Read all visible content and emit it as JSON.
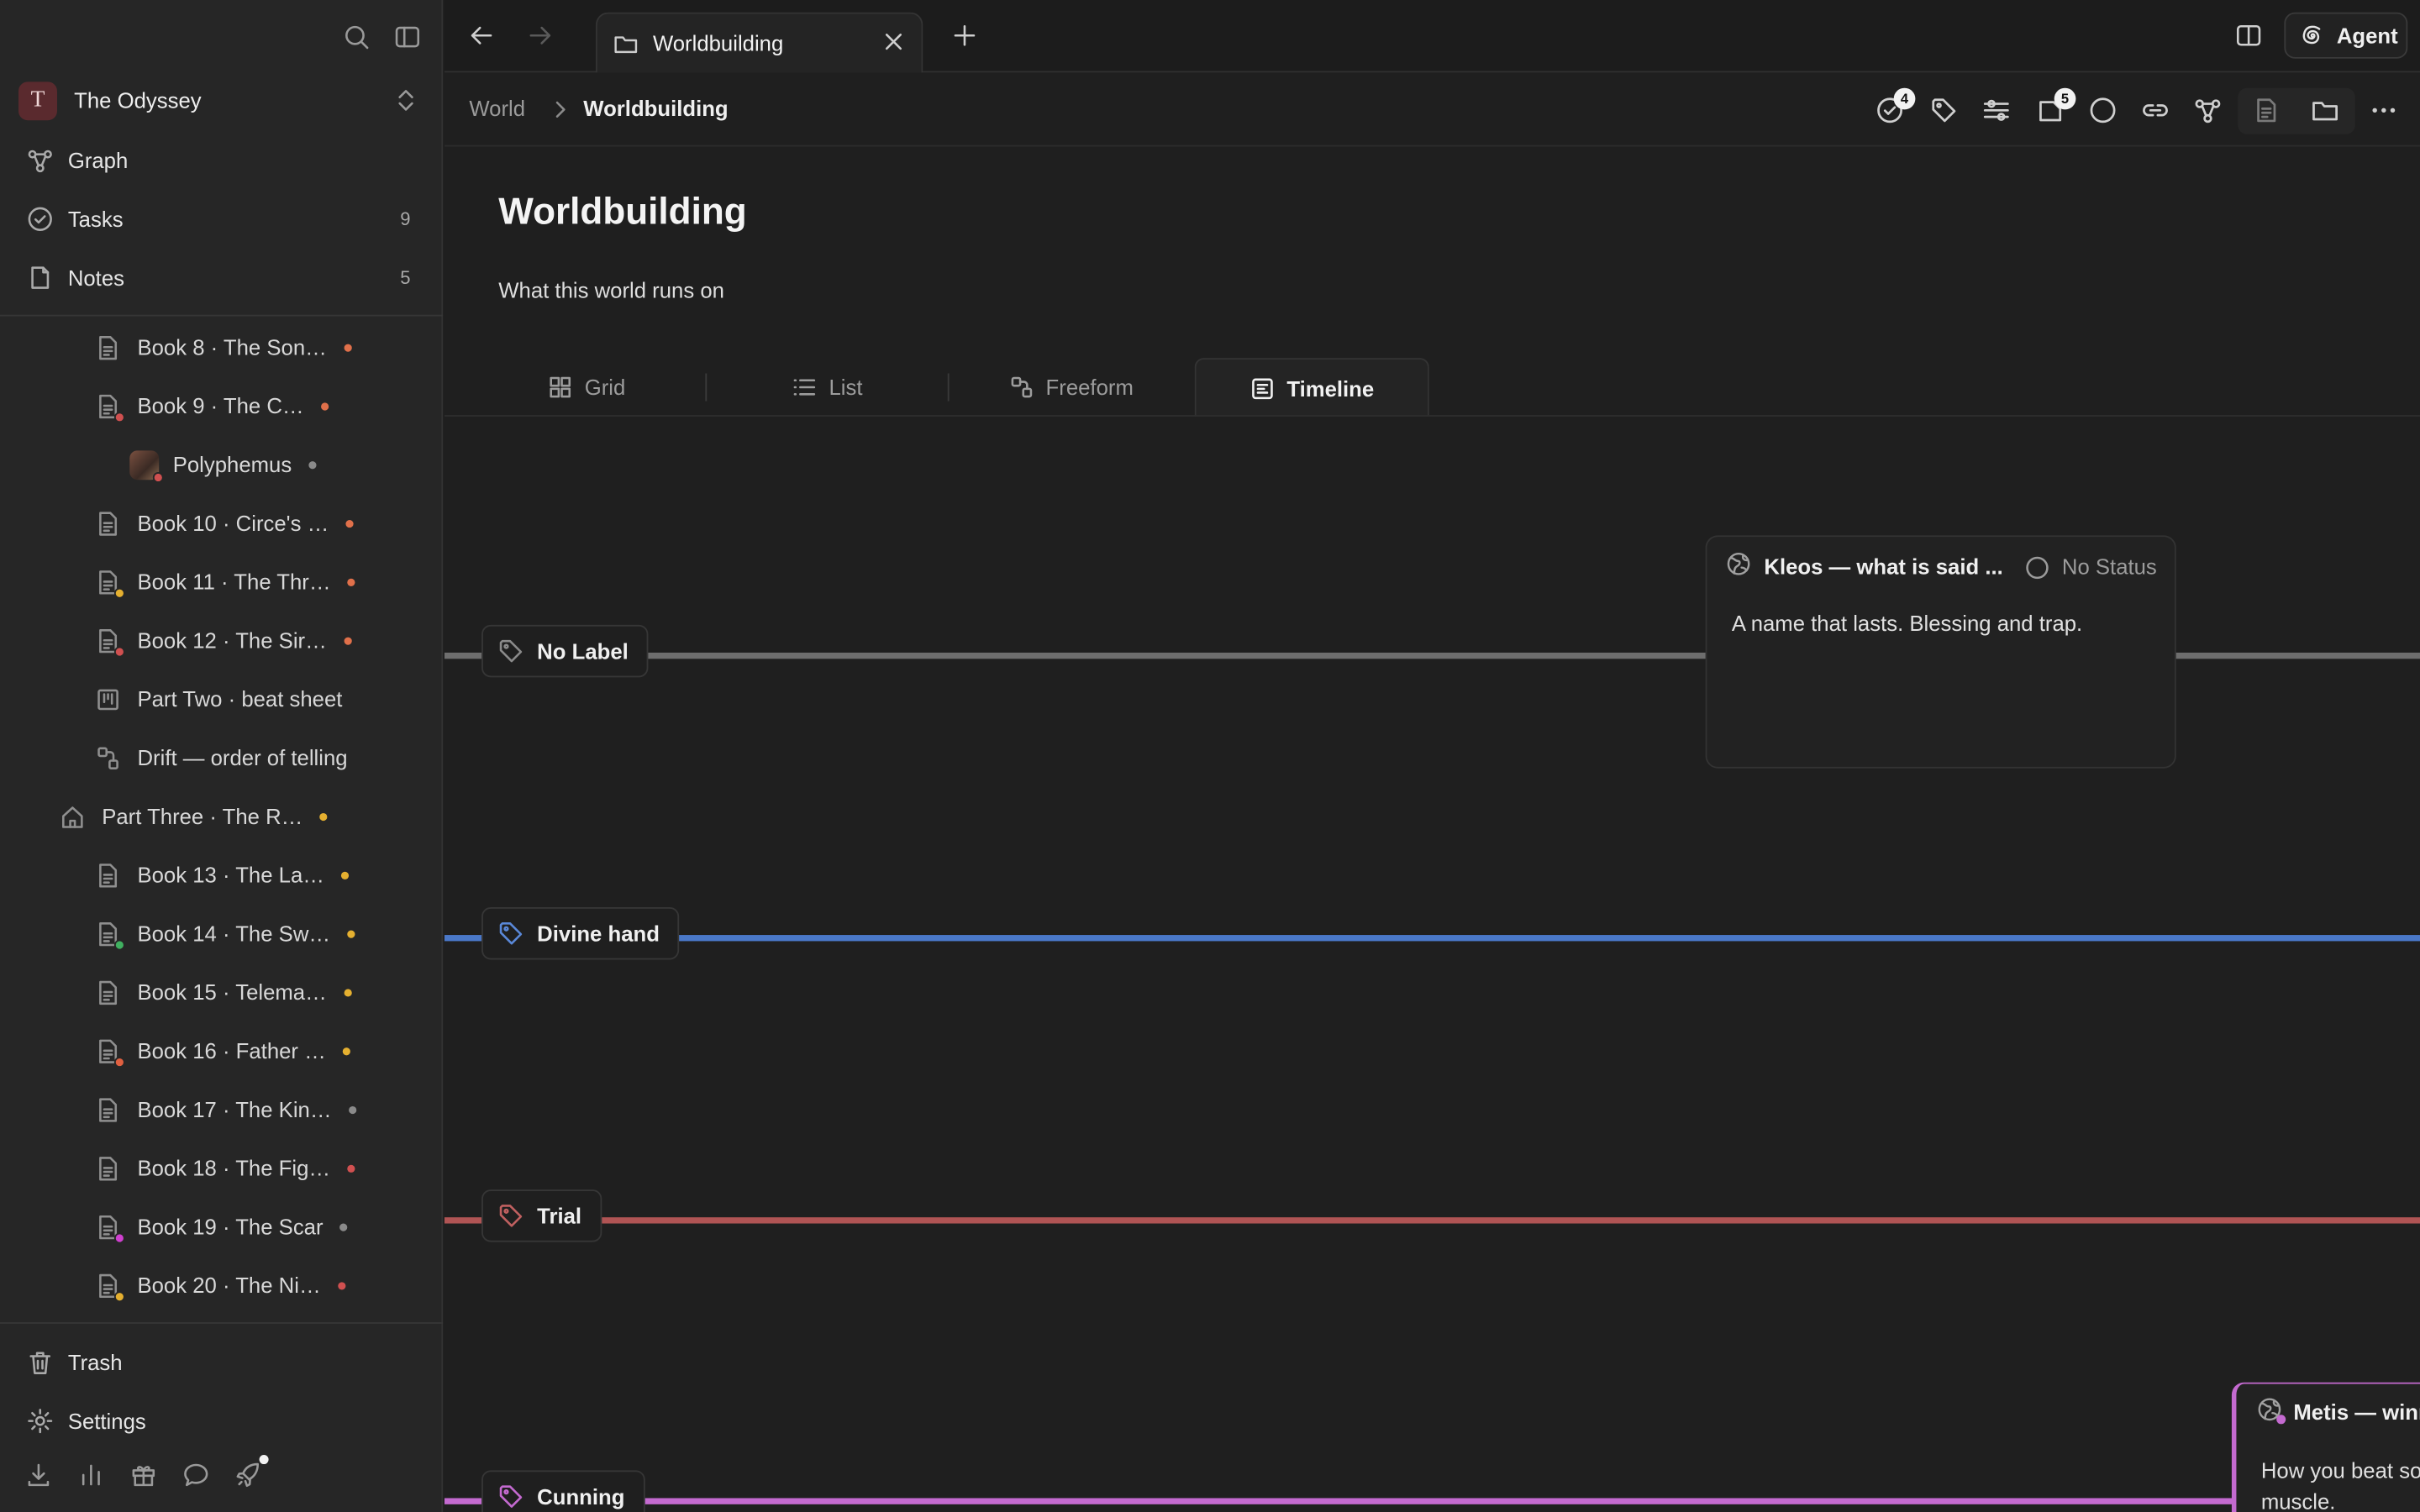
{
  "workspace": {
    "initial": "T",
    "name": "The Odyssey"
  },
  "nav": {
    "graph": "Graph",
    "tasks": {
      "label": "Tasks",
      "count": "9"
    },
    "notes": {
      "label": "Notes",
      "count": "5"
    }
  },
  "tree": [
    {
      "label": "Book 8 · The Son…",
      "icon": "doc-icon",
      "dot": "#e0704a"
    },
    {
      "label": "Book 9 · The C…",
      "icon": "doc-icon",
      "sub": "#d05050",
      "dot": "#e0704a"
    },
    {
      "label": "Polyphemus",
      "icon": "avatar",
      "sub": "#d05050",
      "dot": "#8a8a8a"
    },
    {
      "label": "Book 10 · Circe's …",
      "icon": "doc-icon",
      "dot": "#e0704a"
    },
    {
      "label": "Book 11 · The Thr…",
      "icon": "doc-icon",
      "sub": "#e5b030",
      "dot": "#e0704a"
    },
    {
      "label": "Book 12 · The Sir…",
      "icon": "doc-icon",
      "sub": "#d05050",
      "dot": "#e0704a"
    },
    {
      "label": "Part Two · beat sheet",
      "icon": "board-icon"
    },
    {
      "label": "Drift — order of telling",
      "icon": "freeform-icon"
    },
    {
      "label": "Part Three · The R…",
      "icon": "home-icon",
      "dot": "#e5b030"
    },
    {
      "label": "Book 13 · The La…",
      "icon": "doc-icon",
      "dot": "#e5b030"
    },
    {
      "label": "Book 14 · The Sw…",
      "icon": "doc-icon",
      "sub": "#40b060",
      "dot": "#e5b030"
    },
    {
      "label": "Book 15 · Telema…",
      "icon": "doc-icon",
      "dot": "#e5b030"
    },
    {
      "label": "Book 16 · Father …",
      "icon": "doc-icon",
      "sub": "#e06040",
      "dot": "#e5b030"
    },
    {
      "label": "Book 17 · The Kin…",
      "icon": "doc-icon",
      "dot": "#8a8a8a"
    },
    {
      "label": "Book 18 · The Fig…",
      "icon": "doc-icon",
      "dot": "#d05050"
    },
    {
      "label": "Book 19 · The Scar",
      "icon": "doc-icon",
      "sub": "#d040d0",
      "dot": "#8a8a8a"
    },
    {
      "label": "Book 20 · The Ni…",
      "icon": "doc-icon",
      "sub": "#e5b030",
      "dot": "#d05050"
    }
  ],
  "sidebar_bottom": {
    "trash": "Trash",
    "settings": "Settings"
  },
  "tab": {
    "title": "Worldbuilding"
  },
  "agent_label": "Agent",
  "breadcrumb": {
    "parent": "World",
    "current": "Worldbuilding"
  },
  "header_badges": {
    "tasks": "4",
    "pages": "5"
  },
  "page": {
    "title": "Worldbuilding",
    "description": "What this world runs on"
  },
  "views": {
    "grid": "Grid",
    "list": "List",
    "freeform": "Freeform",
    "timeline": "Timeline",
    "active": "Timeline"
  },
  "lanes": [
    {
      "label": "No Label",
      "color": "#6e6e6e"
    },
    {
      "label": "Divine hand",
      "color": "#4a78c8"
    },
    {
      "label": "Trial",
      "color": "#b05454"
    },
    {
      "label": "Cunning",
      "color": "#c46ad0"
    }
  ],
  "cards": {
    "kleos": {
      "title": "Kleos — what is said ...",
      "status": "No Status",
      "body": "A name that lasts. Blessing and trap."
    },
    "metis": {
      "title": "Metis — winn",
      "body_line1": "How you beat so",
      "body_line2": "muscle."
    }
  },
  "colors": {
    "accent_pink": "#c46ad0",
    "workspace_avatar": "#5a2a2e"
  }
}
